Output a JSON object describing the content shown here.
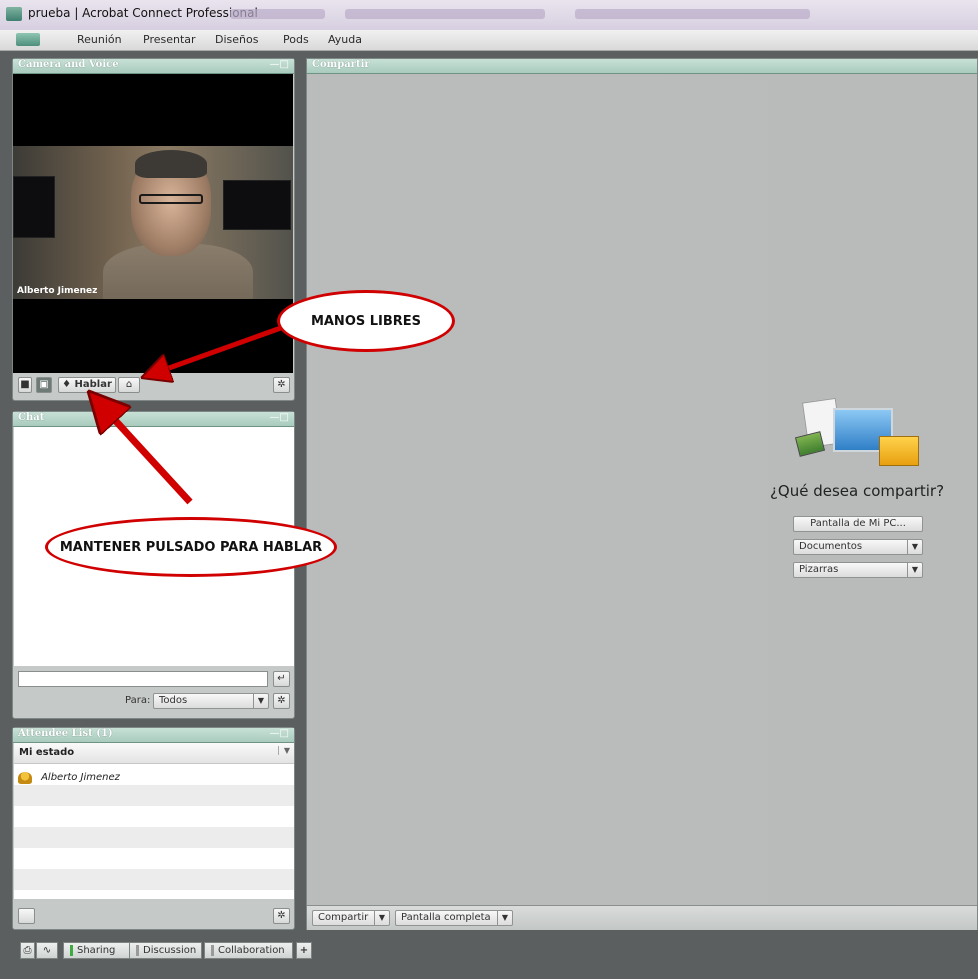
{
  "window": {
    "title": "prueba | Acrobat Connect Professional"
  },
  "menu": {
    "items": [
      "Reunión",
      "Presentar",
      "Diseños",
      "Pods",
      "Ayuda"
    ]
  },
  "camera_pod": {
    "title": "Camera and Voice",
    "speaker_name": "Alberto Jimenez",
    "talk_button": "Hablar"
  },
  "chat_pod": {
    "title": "Chat",
    "to_label": "Para:",
    "to_value": "Todos",
    "input_placeholder": ""
  },
  "attendee_pod": {
    "title": "Attendee List (1)",
    "status_label": "Mi estado",
    "attendees": [
      "Alberto Jimenez"
    ]
  },
  "share_pod": {
    "title": "Compartir",
    "question": "¿Qué desea compartir?",
    "options": [
      "Pantalla de Mi PC...",
      "Documentos",
      "Pizarras"
    ],
    "footer_share": "Compartir",
    "footer_fullscreen": "Pantalla completa"
  },
  "callouts": {
    "hands_free": "MANOS LIBRES",
    "push_to_talk": "MANTENER PULSADO PARA HABLAR"
  },
  "tabs": [
    "Sharing",
    "Discussion",
    "Collaboration"
  ],
  "colors": {
    "pod_header": "#a8cbbd",
    "callout_red": "#d10000",
    "sharing_indicator": "#3faa3f"
  }
}
